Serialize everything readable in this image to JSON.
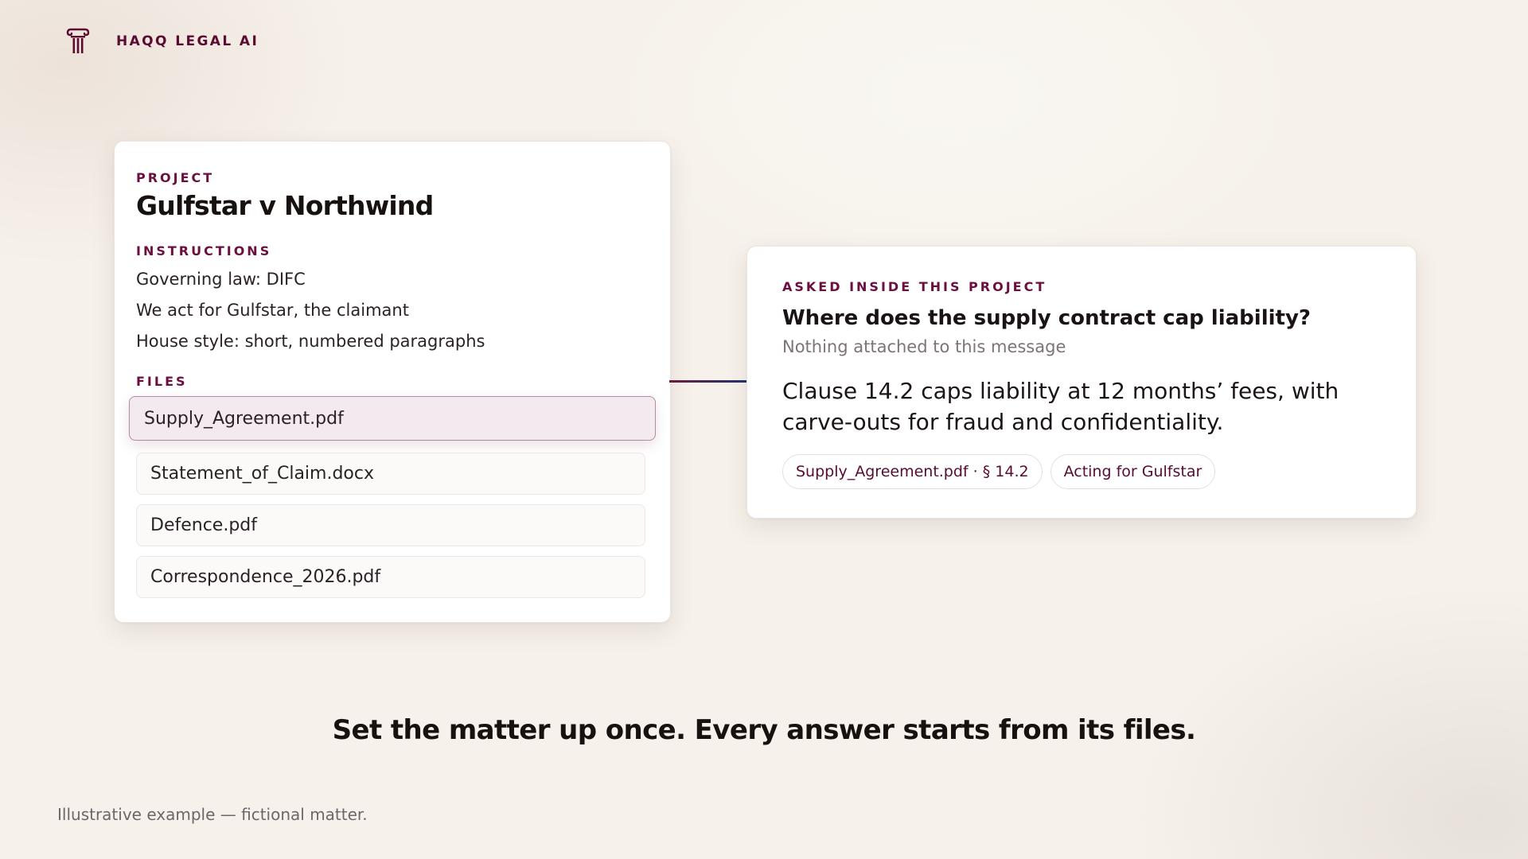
{
  "brand": {
    "name": "HAQQ LEGAL AI",
    "icon": "pillar-icon",
    "color": "#5a0b31"
  },
  "project": {
    "eyebrow": "PROJECT",
    "title": "Gulfstar v Northwind",
    "instructions_label": "INSTRUCTIONS",
    "instructions": [
      "Governing law: DIFC",
      "We act for Gulfstar, the claimant",
      "House style: short, numbered paragraphs"
    ],
    "files_label": "FILES",
    "files": [
      "Supply_Agreement.pdf",
      "Statement_of_Claim.docx",
      "Defence.pdf",
      "Correspondence_2026.pdf"
    ],
    "selected_file": "Supply_Agreement.pdf"
  },
  "answer": {
    "eyebrow": "ASKED INSIDE THIS PROJECT",
    "question": "Where does the supply contract cap liability?",
    "attachment_note": "Nothing attached to this message",
    "text": "Clause 14.2 caps liability at 12 months’ fees, with carve-outs for fraud and confidentiality.",
    "chips": [
      "Supply_Agreement.pdf · § 14.2",
      "Acting for Gulfstar"
    ]
  },
  "tagline": "Set the matter up once. Every answer starts from its files.",
  "footnote": "Illustrative example — fictional matter.",
  "colors": {
    "accent": "#6b0f3e",
    "background": "#f6f1ea",
    "connector_start": "#6b1a3c",
    "connector_end": "#1f3570"
  }
}
